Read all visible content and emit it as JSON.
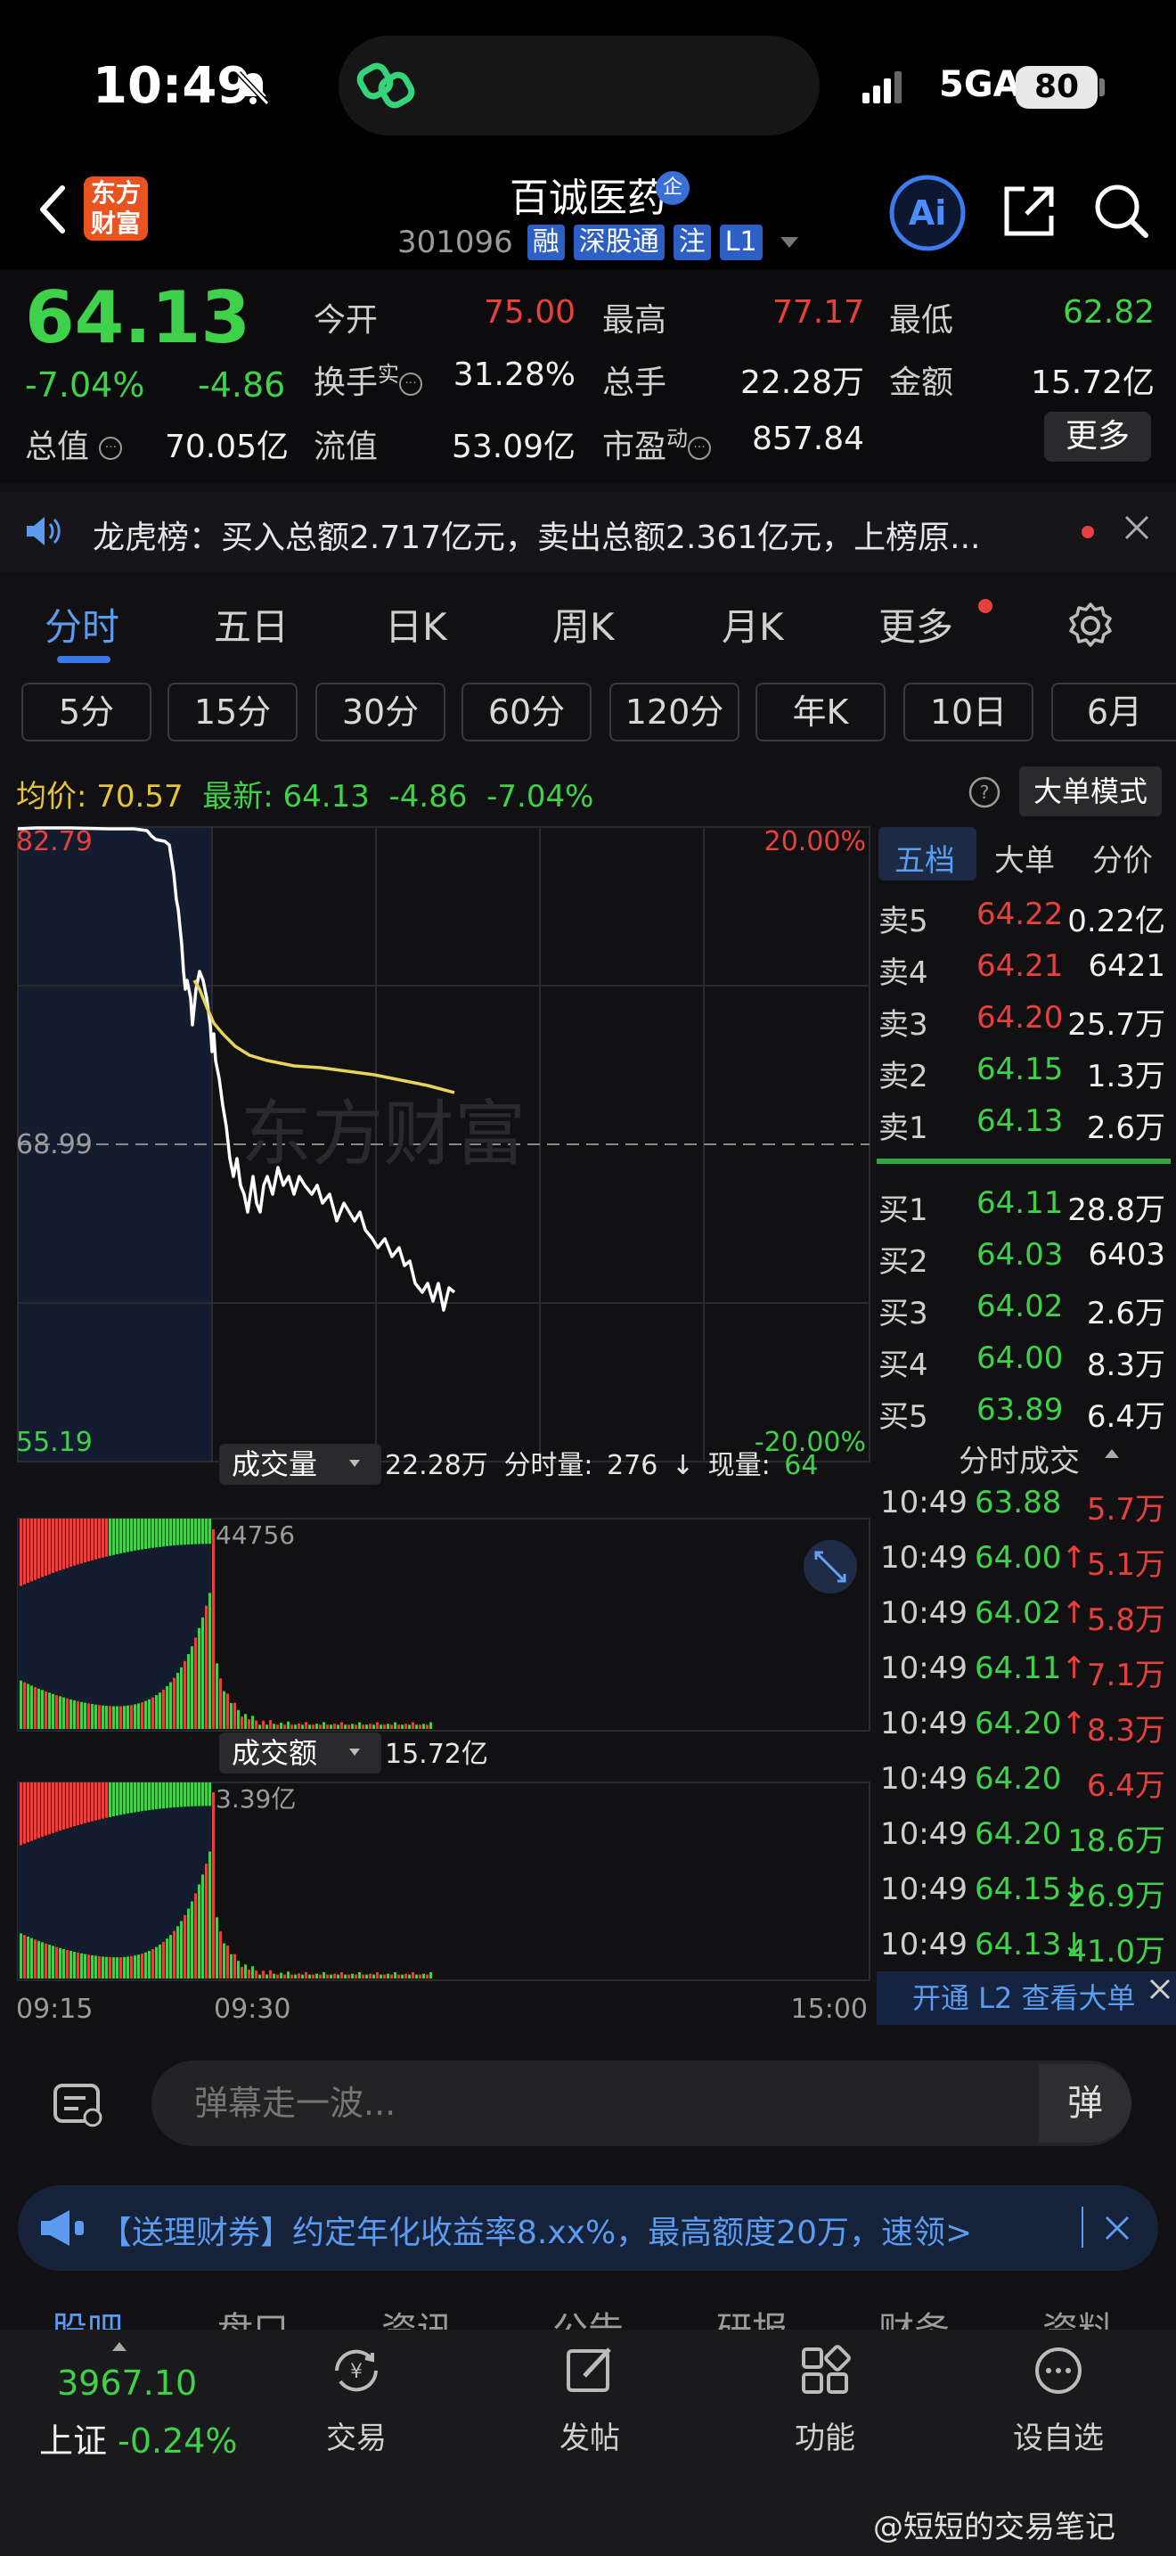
{
  "status": {
    "time": "10:49",
    "network": "5GA",
    "battery": "80"
  },
  "header": {
    "logo_text_1": "东方",
    "logo_text_2": "财富",
    "stock_name": "百诚医药",
    "name_badge": "企",
    "stock_code": "301096",
    "tags": [
      "融",
      "深股通",
      "注",
      "L1"
    ]
  },
  "quote": {
    "last_price": "64.13",
    "change_pct": "-7.04%",
    "change_amt": "-4.86",
    "open_label": "今开",
    "open": "75.00",
    "high_label": "最高",
    "high": "77.17",
    "low_label": "最低",
    "low": "62.82",
    "turnover_label": "换手",
    "turnover_sup": "实",
    "turnover": "31.28%",
    "volume_label": "总手",
    "volume": "22.28万",
    "amount_label": "金额",
    "amount": "15.72亿",
    "mcap_label": "总值",
    "mcap": "70.05亿",
    "float_label": "流值",
    "float": "53.09亿",
    "pe_label": "市盈",
    "pe_sup": "动",
    "pe": "857.84",
    "more_label": "更多"
  },
  "notice": {
    "text": "龙虎榜：买入总额2.717亿元，卖出总额2.361亿元，上榜原..."
  },
  "main_tabs": [
    "分时",
    "五日",
    "日K",
    "周K",
    "月K",
    "更多"
  ],
  "period_tabs": [
    "5分",
    "15分",
    "30分",
    "60分",
    "120分",
    "年K",
    "10日",
    "6月"
  ],
  "chart_header": {
    "avg_label": "均价:",
    "avg": "70.57",
    "latest_label": "最新:",
    "latest": "64.13",
    "latest_chg": "-4.86",
    "latest_pct": "-7.04%",
    "bigorder": "大单模式"
  },
  "chart_data": {
    "type": "line",
    "y_top": "82.79",
    "y_mid": "68.99",
    "y_bottom": "55.19",
    "pct_top": "20.00%",
    "pct_bottom": "-20.00%",
    "ylim": [
      55.19,
      82.79
    ],
    "x_labels": [
      "09:15",
      "09:30",
      "15:00"
    ],
    "watermark": "东方财富",
    "volume_label": "成交量",
    "volume_total": "22.28万",
    "volume_detail_label": "分时量:",
    "volume_detail": "276",
    "volume_now_label": "现量:",
    "volume_now": "64",
    "volume_max": "44756",
    "amount_label": "成交额",
    "amount_total": "15.72亿",
    "amount_max": "3.39亿",
    "colors": {
      "price": "#ffffff",
      "avg": "#e8d45a",
      "up": "#e8403c",
      "down": "#3fd14a"
    }
  },
  "orderbook": {
    "tabs": [
      "五档",
      "大单",
      "分价"
    ],
    "asks": [
      {
        "label": "卖5",
        "price": "64.22",
        "vol": "0.22亿"
      },
      {
        "label": "卖4",
        "price": "64.21",
        "vol": "6421"
      },
      {
        "label": "卖3",
        "price": "64.20",
        "vol": "25.7万"
      },
      {
        "label": "卖2",
        "price": "64.15",
        "vol": "1.3万"
      },
      {
        "label": "卖1",
        "price": "64.13",
        "vol": "2.6万"
      }
    ],
    "bids": [
      {
        "label": "买1",
        "price": "64.11",
        "vol": "28.8万"
      },
      {
        "label": "买2",
        "price": "64.03",
        "vol": "6403"
      },
      {
        "label": "买3",
        "price": "64.02",
        "vol": "2.6万"
      },
      {
        "label": "买4",
        "price": "64.00",
        "vol": "8.3万"
      },
      {
        "label": "买5",
        "price": "63.89",
        "vol": "6.4万"
      }
    ],
    "trades_title": "分时成交",
    "trades": [
      {
        "time": "10:49",
        "price": "63.88",
        "vol": "5.7万",
        "dir": "",
        "color": "red"
      },
      {
        "time": "10:49",
        "price": "64.00",
        "vol": "5.1万",
        "dir": "↑",
        "color": "red"
      },
      {
        "time": "10:49",
        "price": "64.02",
        "vol": "5.8万",
        "dir": "↑",
        "color": "red"
      },
      {
        "time": "10:49",
        "price": "64.11",
        "vol": "7.1万",
        "dir": "↑",
        "color": "red"
      },
      {
        "time": "10:49",
        "price": "64.20",
        "vol": "8.3万",
        "dir": "↑",
        "color": "red"
      },
      {
        "time": "10:49",
        "price": "64.20",
        "vol": "6.4万",
        "dir": "",
        "color": "red"
      },
      {
        "time": "10:49",
        "price": "64.20",
        "vol": "18.6万",
        "dir": "",
        "color": "green"
      },
      {
        "time": "10:49",
        "price": "64.15",
        "vol": "26.9万",
        "dir": "↓",
        "color": "green"
      },
      {
        "time": "10:49",
        "price": "64.13",
        "vol": "41.0万",
        "dir": "↓",
        "color": "green"
      }
    ],
    "l2_text": "开通 L2 查看大单"
  },
  "danmu": {
    "placeholder": "弹幕走一波...",
    "button": "弹"
  },
  "promo": {
    "text": "【送理财券】约定年化收益率8.xx%，最高额度20万，速领>"
  },
  "content_tabs": [
    "股吧",
    "盘口",
    "资讯",
    "公告",
    "研报",
    "财务",
    "资料"
  ],
  "bottom_nav": {
    "index_value": "3967.10",
    "index_name": "上证",
    "index_pct": "-0.24%",
    "items": [
      "交易",
      "发帖",
      "功能",
      "设自选"
    ]
  },
  "watermark": "@短短的交易笔记"
}
